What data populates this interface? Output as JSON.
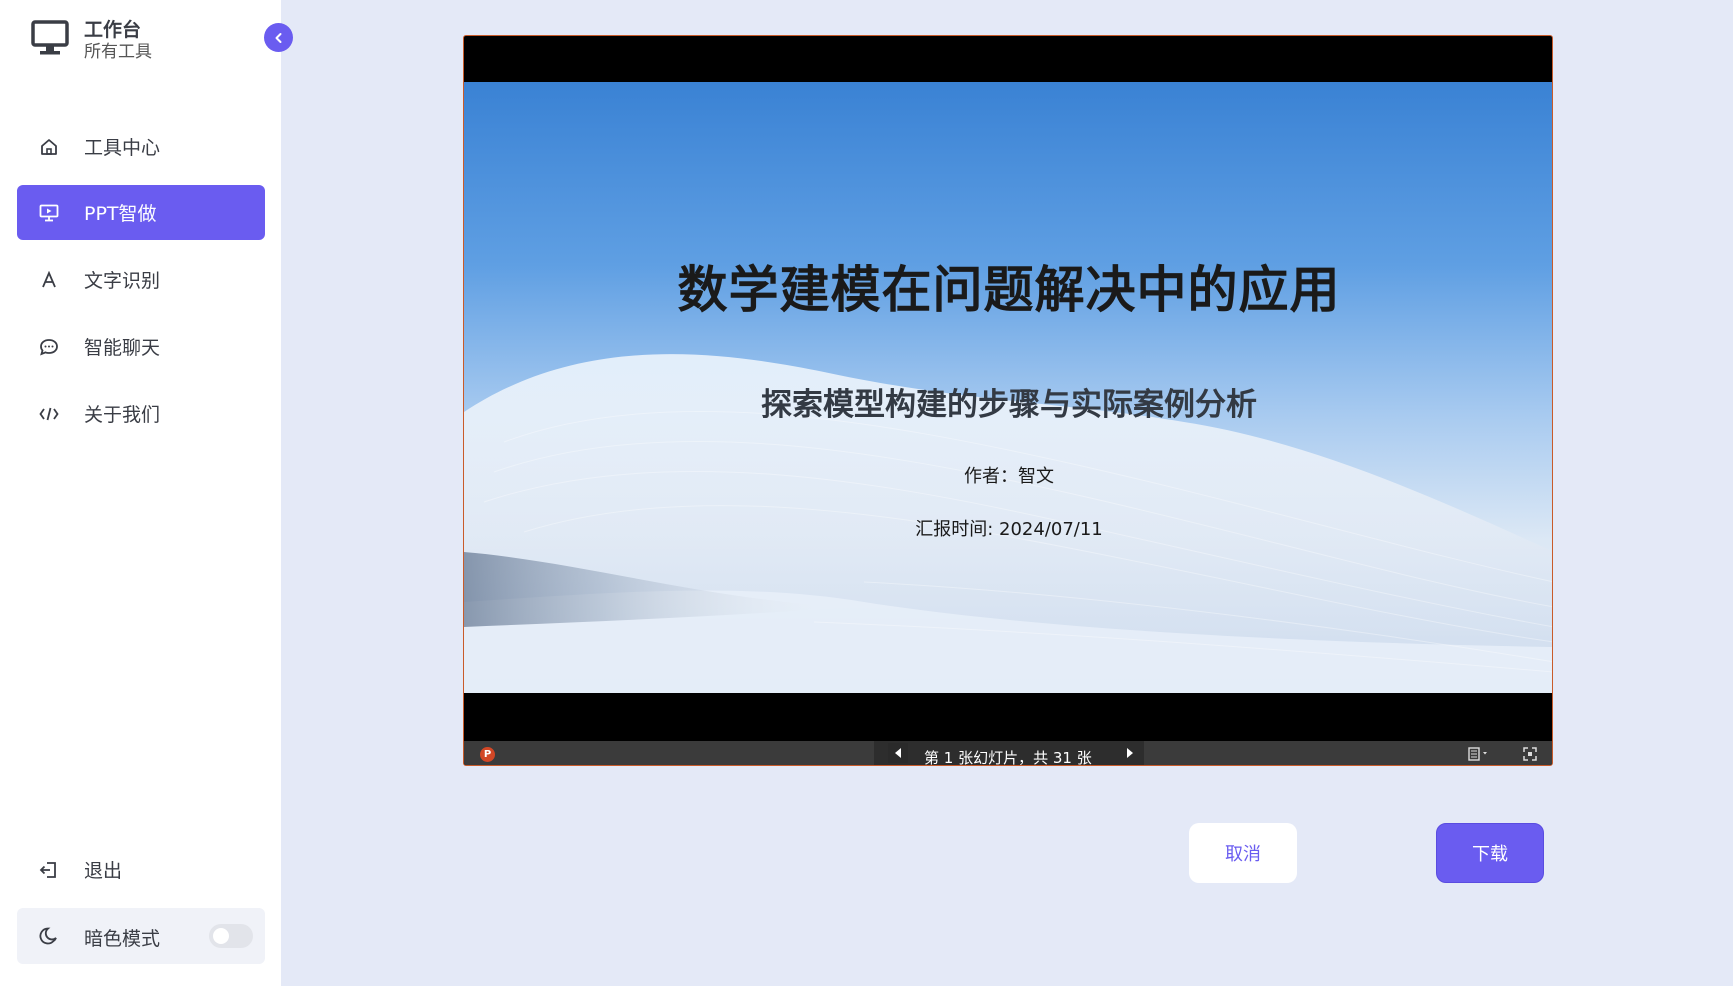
{
  "brand": {
    "title": "工作台",
    "subtitle": "所有工具"
  },
  "sidebar": {
    "items": [
      {
        "label": "工具中心",
        "icon": "home-icon"
      },
      {
        "label": "PPT智做",
        "icon": "presentation-icon",
        "active": true
      },
      {
        "label": "文字识别",
        "icon": "text-a-icon"
      },
      {
        "label": "智能聊天",
        "icon": "chat-bubble-icon"
      },
      {
        "label": "关于我们",
        "icon": "code-icon"
      }
    ],
    "logout_label": "退出",
    "dark_mode_label": "暗色模式",
    "dark_mode_on": false
  },
  "slide": {
    "title": "数学建模在问题解决中的应用",
    "subtitle": "探索模型构建的步骤与实际案例分析",
    "author": "作者：智文",
    "date": "汇报时间: 2024/07/11"
  },
  "viewer": {
    "slide_counter": "第 1 张幻灯片，共 31 张"
  },
  "actions": {
    "cancel_label": "取消",
    "download_label": "下载"
  },
  "colors": {
    "accent": "#6a5cf0",
    "background": "#e4e9f7"
  }
}
